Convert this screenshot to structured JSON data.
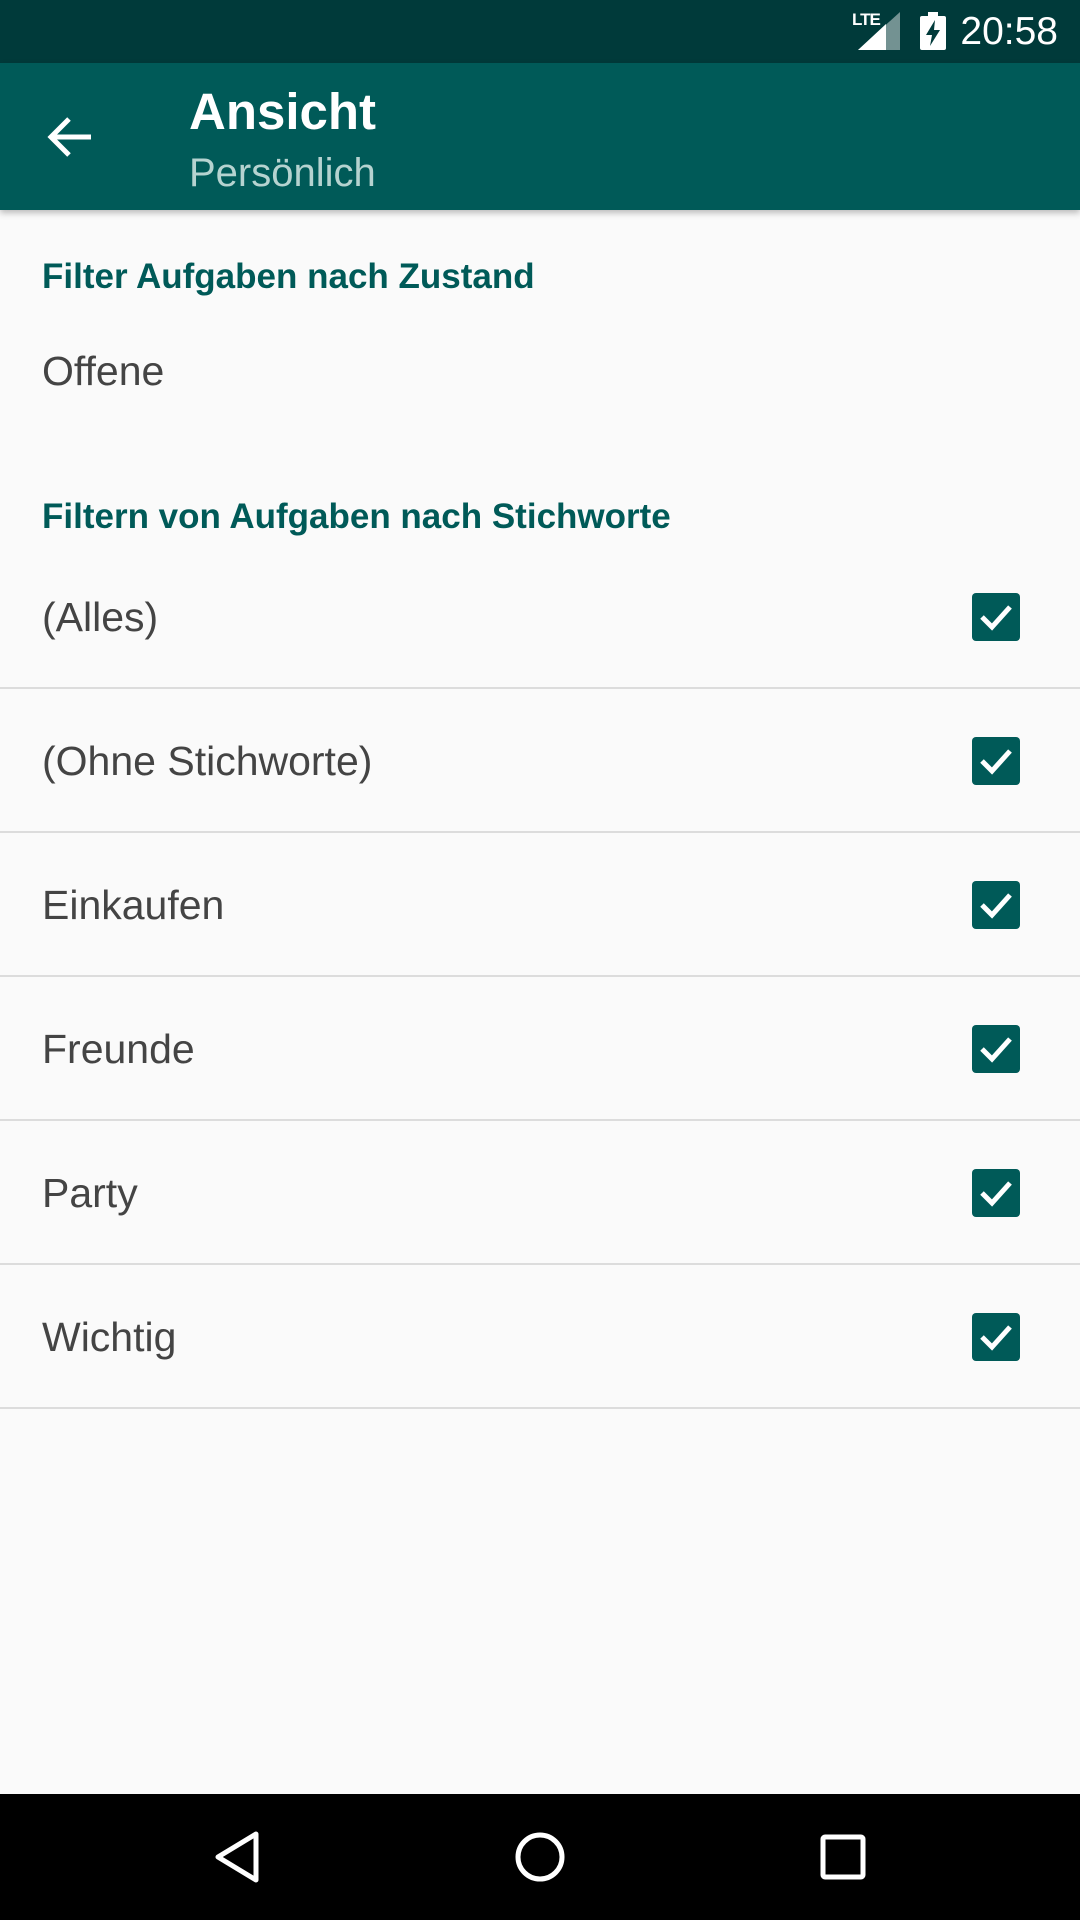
{
  "status_bar": {
    "network_label": "LTE",
    "time": "20:58"
  },
  "app_bar": {
    "title": "Ansicht",
    "subtitle": "Persönlich",
    "back_icon": "arrow-back-icon"
  },
  "state_filter": {
    "header": "Filter Aufgaben nach Zustand",
    "value": "Offene"
  },
  "tag_filter": {
    "header": "Filtern von Aufgaben nach Stichworte",
    "items": [
      {
        "label": "(Alles)",
        "checked": true
      },
      {
        "label": "(Ohne Stichworte)",
        "checked": true
      },
      {
        "label": "Einkaufen",
        "checked": true
      },
      {
        "label": "Freunde",
        "checked": true
      },
      {
        "label": "Party",
        "checked": true
      },
      {
        "label": "Wichtig",
        "checked": true
      }
    ]
  },
  "colors": {
    "status_bar": "#003a3a",
    "app_bar": "#005a58",
    "accent": "#005a58",
    "background": "#fafafa"
  },
  "nav_bar": {
    "icons": [
      "back-triangle-icon",
      "home-circle-icon",
      "recents-square-icon"
    ]
  }
}
